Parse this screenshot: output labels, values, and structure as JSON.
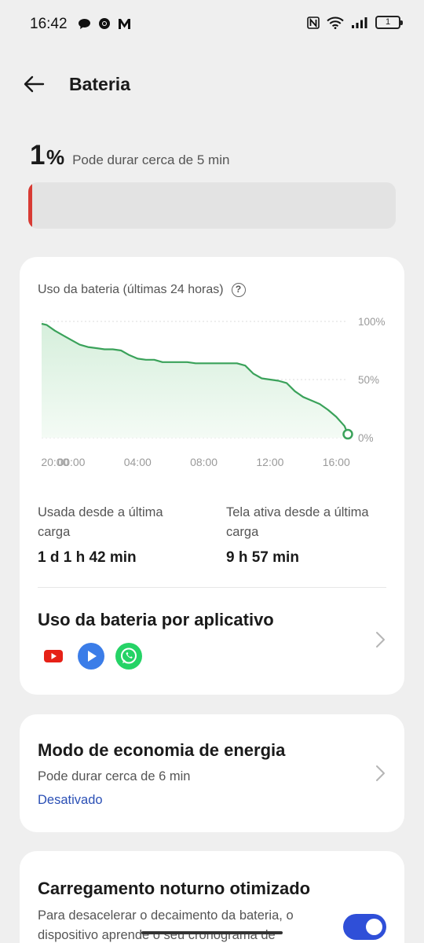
{
  "status_bar": {
    "time": "16:42",
    "battery_level": "1"
  },
  "header": {
    "title": "Bateria"
  },
  "battery": {
    "percent": "1",
    "percent_symbol": "%",
    "estimate": "Pode durar cerca de 5 min",
    "level_fraction": 0.01,
    "fill_color": "#d83b34"
  },
  "usage_card": {
    "chart_title": "Uso da bateria (últimas 24 horas)",
    "used_label": "Usada desde a última carga",
    "used_value": "1 d 1 h 42 min",
    "screen_label": "Tela ativa desde a última carga",
    "screen_value": "9 h 57 min",
    "apps_title": "Uso da bateria por aplicativo",
    "apps": [
      {
        "name": "youtube-icon",
        "color": "#e62117"
      },
      {
        "name": "play-icon",
        "color": "#3b7de8"
      },
      {
        "name": "whatsapp-icon",
        "color": "#25d366"
      }
    ]
  },
  "chart_data": {
    "type": "area",
    "x_tick_labels": [
      "20:00",
      "00:00",
      "04:00",
      "08:00",
      "12:00",
      "16:00"
    ],
    "y_tick_labels": [
      "100%",
      "50%",
      "0%"
    ],
    "ylim": [
      0,
      100
    ],
    "x_hours": [
      -1.8,
      -1.5,
      -1,
      -0.5,
      0,
      0.5,
      1,
      1.5,
      2,
      2.5,
      3,
      3.5,
      4,
      4.5,
      5,
      5.5,
      6,
      6.5,
      7,
      7.5,
      8,
      8.5,
      9,
      9.5,
      10,
      10.5,
      11,
      11.5,
      12,
      12.5,
      13,
      13.5,
      14,
      14.5,
      15,
      15.5,
      16,
      16.5,
      16.7
    ],
    "y_percent": [
      98,
      97,
      92,
      88,
      84,
      80,
      78,
      77,
      76,
      76,
      75,
      71,
      68,
      67,
      67,
      65,
      65,
      65,
      65,
      64,
      64,
      64,
      64,
      64,
      64,
      62,
      55,
      51,
      50,
      49,
      47,
      40,
      35,
      32,
      29,
      24,
      18,
      10,
      3
    ],
    "line_color": "#3aa25a",
    "fill_color": "#d6efdc",
    "grid": true
  },
  "power_saving": {
    "title": "Modo de economia de energia",
    "subtitle": "Pode durar cerca de 6 min",
    "state": "Desativado"
  },
  "night_charging": {
    "title": "Carregamento noturno otimizado",
    "description": "Para desacelerar o decaimento da bateria, o dispositivo aprende o seu cronograma de",
    "enabled": true
  }
}
